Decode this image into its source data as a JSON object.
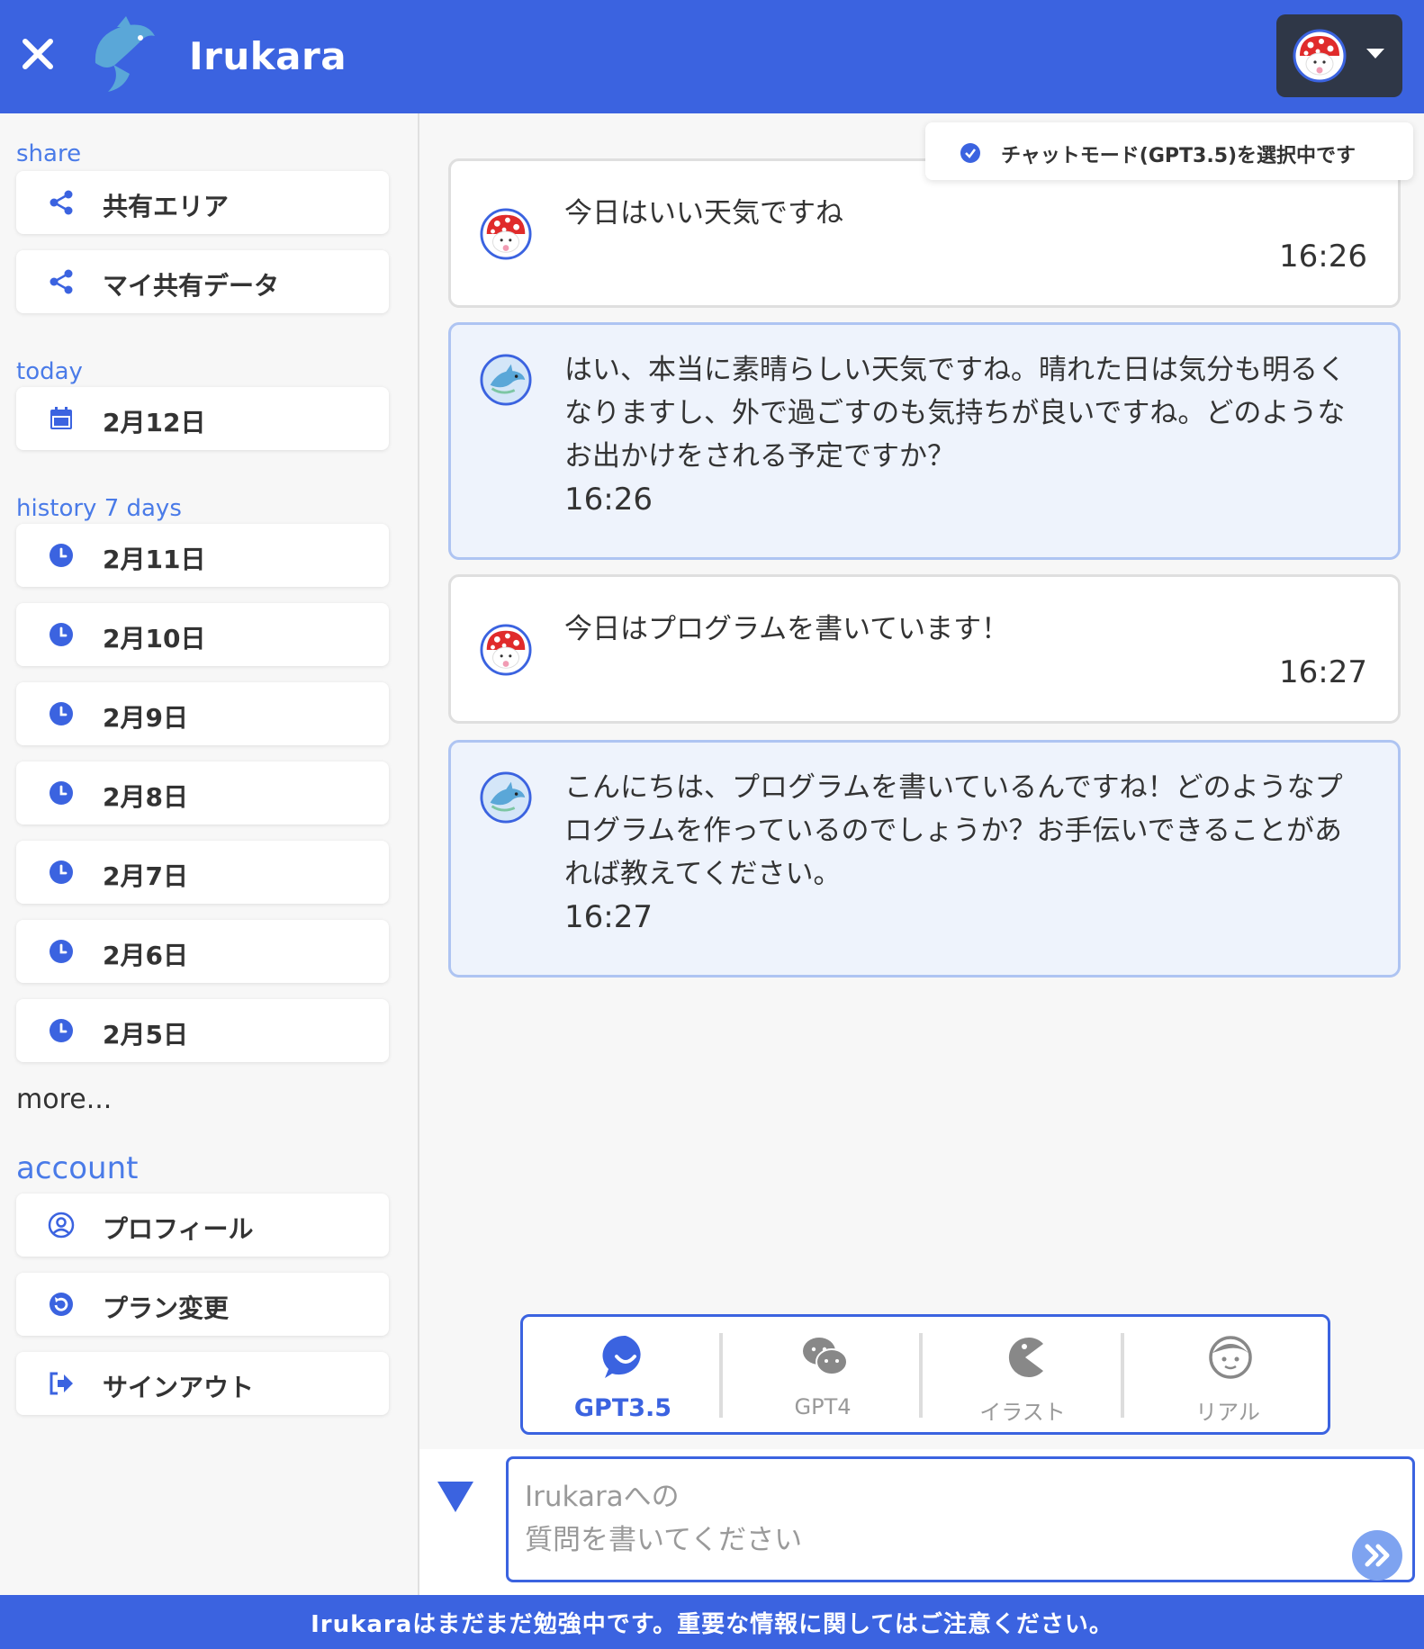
{
  "header": {
    "brand": "Irukara",
    "close_icon": "close-icon",
    "logo_icon": "dolphin-logo-icon",
    "account_caret": "caret-down-icon"
  },
  "sidebar": {
    "share_title": "share",
    "share_items": [
      {
        "label": "共有エリア",
        "icon": "share-icon"
      },
      {
        "label": "マイ共有データ",
        "icon": "share-icon"
      }
    ],
    "today_title": "today",
    "today_items": [
      {
        "label": "2月12日",
        "icon": "calendar-icon"
      }
    ],
    "history_title": "history 7 days",
    "history_items": [
      {
        "label": "2月11日",
        "icon": "clock-icon"
      },
      {
        "label": "2月10日",
        "icon": "clock-icon"
      },
      {
        "label": "2月9日",
        "icon": "clock-icon"
      },
      {
        "label": "2月8日",
        "icon": "clock-icon"
      },
      {
        "label": "2月7日",
        "icon": "clock-icon"
      },
      {
        "label": "2月6日",
        "icon": "clock-icon"
      },
      {
        "label": "2月5日",
        "icon": "clock-icon"
      }
    ],
    "more": "more...",
    "account_title": "account",
    "account_items": [
      {
        "label": "プロフィール",
        "icon": "user-circle-icon"
      },
      {
        "label": "プラン変更",
        "icon": "refresh-icon"
      },
      {
        "label": "サインアウト",
        "icon": "sign-out-icon"
      }
    ]
  },
  "toast": {
    "text": "チャットモード(GPT3.5)を選択中です",
    "icon": "check-circle-icon"
  },
  "messages": [
    {
      "role": "user",
      "text": "今日はいい天気ですね",
      "time": "16:26"
    },
    {
      "role": "bot",
      "text": "はい、本当に素晴らしい天気ですね。晴れた日は気分も明るくなりますし、外で過ごすのも気持ちが良いですね。どのようなお出かけをされる予定ですか？",
      "time": "16:26"
    },
    {
      "role": "user",
      "text": "今日はプログラムを書いています！",
      "time": "16:27"
    },
    {
      "role": "bot",
      "text": "こんにちは、プログラムを書いているんですね！どのようなプログラムを作っているのでしょうか？お手伝いできることがあれば教えてください。",
      "time": "16:27"
    }
  ],
  "modes": [
    {
      "label": "GPT3.5",
      "icon": "smile-chat-icon",
      "active": true
    },
    {
      "label": "GPT4",
      "icon": "wechat-icon",
      "active": false
    },
    {
      "label": "イラスト",
      "icon": "pacman-icon",
      "active": false
    },
    {
      "label": "リアル",
      "icon": "face-icon",
      "active": false
    }
  ],
  "input": {
    "placeholder": "Irukaraへの\n質問を書いてください",
    "send_icon": "double-chevron-right-icon",
    "scroll_icon": "triangle-down-icon"
  },
  "footer": {
    "notice": "Irukaraはまだまだ勉強中です。重要な情報に関してはご注意ください。"
  },
  "colors": {
    "primary": "#3b63e0",
    "bot_bubble": "#eef3fc",
    "section_title": "#4a7be8",
    "account_menu": "#2f3747"
  }
}
